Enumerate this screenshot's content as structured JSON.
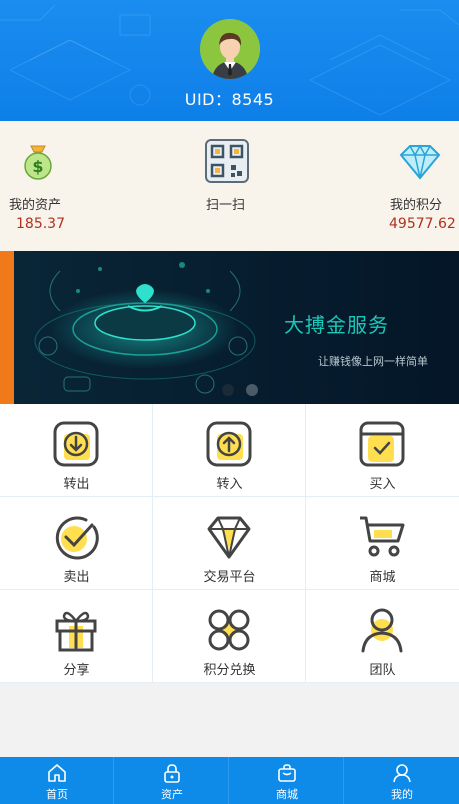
{
  "profile": {
    "uid_label": "UID：8545"
  },
  "stats": [
    {
      "label": "我的资产",
      "value": "185.37",
      "icon": "money-bag-icon"
    },
    {
      "label": "扫一扫",
      "value": "",
      "icon": "qr-code-icon"
    },
    {
      "label": "我的积分",
      "value": "49577.62",
      "icon": "diamond-icon"
    }
  ],
  "banner": {
    "title": "大搏金服务",
    "subtitle": "让赚钱像上网一样简单",
    "slide_count": 2,
    "active_slide": 0
  },
  "menu": [
    {
      "label": "转出",
      "icon": "arrow-down-icon"
    },
    {
      "label": "转入",
      "icon": "arrow-up-icon"
    },
    {
      "label": "买入",
      "icon": "checked-box-icon"
    },
    {
      "label": "卖出",
      "icon": "check-circle-icon"
    },
    {
      "label": "交易平台",
      "icon": "diamond-outline-icon"
    },
    {
      "label": "商城",
      "icon": "cart-icon"
    },
    {
      "label": "分享",
      "icon": "gift-icon"
    },
    {
      "label": "积分兑换",
      "icon": "clover-icon"
    },
    {
      "label": "团队",
      "icon": "user-icon"
    }
  ],
  "tabbar": [
    {
      "label": "首页",
      "icon": "home-icon"
    },
    {
      "label": "资产",
      "icon": "lock-icon"
    },
    {
      "label": "商城",
      "icon": "bag-icon"
    },
    {
      "label": "我的",
      "icon": "person-icon"
    }
  ],
  "colors": {
    "brand_blue": "#0e8ae8",
    "accent_yellow": "#ffde4f",
    "value_red": "#b0301e",
    "banner_teal": "#19c8b8"
  }
}
